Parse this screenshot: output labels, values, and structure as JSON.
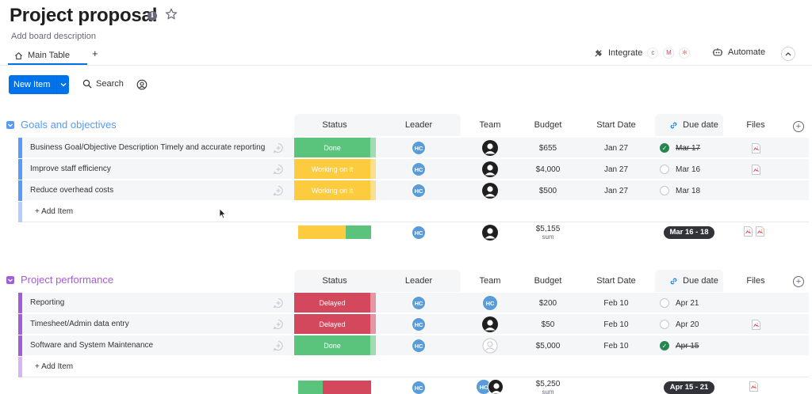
{
  "board": {
    "title": "Project proposal",
    "description": "Add board description",
    "info_icon": "info-icon",
    "star_icon": "star-icon"
  },
  "tabs": {
    "main_tab": "Main Table",
    "add_tab": "+"
  },
  "toolbar": {
    "integrate": "Integrate",
    "automate": "Automate",
    "new_item": "New Item",
    "search": "Search"
  },
  "columns": {
    "status": "Status",
    "leader": "Leader",
    "team": "Team",
    "budget": "Budget",
    "start_date": "Start Date",
    "due_date": "Due date",
    "files": "Files"
  },
  "colors": {
    "accent": "#0073ea",
    "done": "#5ac47d",
    "working": "#fdcb3e",
    "delayed": "#d4485e",
    "group1": "#579bfc",
    "group2": "#a25ddc"
  },
  "groups": [
    {
      "title": "Goals and objectives",
      "rows": [
        {
          "name": "Business Goal/Objective Description Timely and accurate reporting",
          "status": "Done",
          "leader": "HC",
          "budget": "$655",
          "start": "Jan 27",
          "due": "Mar 17",
          "due_done": true
        },
        {
          "name": "Improve staff efficiency",
          "status": "Working on it",
          "leader": "HC",
          "budget": "$4,000",
          "start": "Jan 27",
          "due": "Mar 16",
          "due_done": false
        },
        {
          "name": "Reduce overhead costs",
          "status": "Working on it",
          "leader": "HC",
          "budget": "$500",
          "start": "Jan 27",
          "due": "Mar 18",
          "due_done": false
        }
      ],
      "add_item": "+ Add Item",
      "summary": {
        "leader": "HC",
        "budget": "$5,155",
        "budget_label": "sum",
        "due_range": "Mar 16 - 18",
        "status_fraction_working": 0.67,
        "status_fraction_done": 0.33
      }
    },
    {
      "title": "Project performance",
      "rows": [
        {
          "name": "Reporting",
          "status": "Delayed",
          "leader": "HC",
          "team": "HC",
          "budget": "$200",
          "start": "Feb 10",
          "due": "Apr 21",
          "due_done": false
        },
        {
          "name": "Timesheet/Admin data entry",
          "status": "Delayed",
          "leader": "HC",
          "budget": "$50",
          "start": "Feb 10",
          "due": "Apr 20",
          "due_done": false
        },
        {
          "name": "Software and System Maintenance",
          "status": "Done",
          "leader": "HC",
          "budget": "$5,000",
          "start": "Feb 10",
          "due": "Apr 15",
          "due_done": true
        }
      ],
      "add_item": "+ Add Item",
      "summary": {
        "leader": "HC",
        "team": "HC",
        "budget": "$5,250",
        "budget_label": "sum",
        "due_range": "Apr 15 - 21",
        "status_fraction_done": 0.33,
        "status_fraction_delayed": 0.67
      }
    }
  ]
}
